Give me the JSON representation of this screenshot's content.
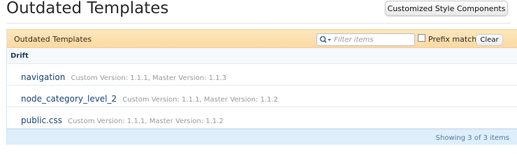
{
  "header": {
    "title": "Outdated Templates",
    "customized_button_label": "Customized Style Components"
  },
  "panel": {
    "title": "Outdated Templates",
    "filter": {
      "placeholder": "Filter items",
      "value": "",
      "icon": "search-dropdown-icon"
    },
    "prefix_match_label": "Prefix match",
    "prefix_match_checked": false,
    "clear_label": "Clear",
    "group": {
      "label": "Drift",
      "items": [
        {
          "name": "navigation",
          "meta": "Custom Version: 1.1.1, Master Version: 1.1.3"
        },
        {
          "name": "node_category_level_2",
          "meta": "Custom Version: 1.1.1, Master Version: 1.1.2"
        },
        {
          "name": "public.css",
          "meta": "Custom Version: 1.1.1, Master Version: 1.1.2"
        }
      ]
    },
    "footer_count": "Showing 3 of 3 items"
  },
  "colors": {
    "header_bg": "#fbd9a3",
    "link": "#18457a",
    "footer_bg": "#deeefa"
  }
}
